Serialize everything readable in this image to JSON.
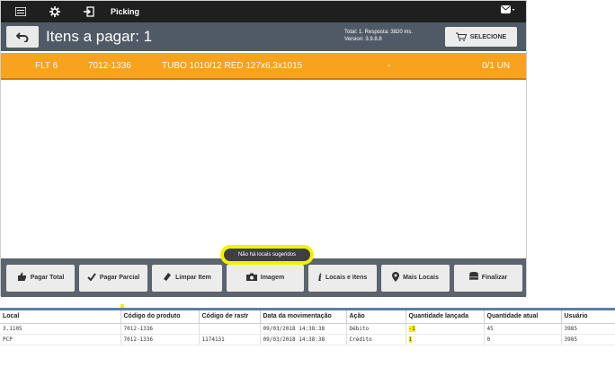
{
  "topbar": {
    "title": "Picking"
  },
  "subbar": {
    "title": "Itens a pagar: 1",
    "info_line1": "Total: 1. Resposta: 3820 ms.",
    "info_line2": "Version: 3.9.8.8",
    "select_label": "SELECIONE"
  },
  "item": {
    "location": "FLT 6",
    "code": "7012-1336",
    "description": "TUBO 1010/12 RED 127x6,3x1015",
    "dash": "-",
    "quantity": "0/1 UN"
  },
  "tooltip": "Não há locais sugeridos",
  "buttons": [
    {
      "label": "Pagar Total",
      "icon": "thumbs-up-icon"
    },
    {
      "label": "Pagar Parcial",
      "icon": "check-icon"
    },
    {
      "label": "Limpar Item",
      "icon": "eraser-icon"
    },
    {
      "label": "Imagem",
      "icon": "camera-icon"
    },
    {
      "label": "Locais e Itens",
      "icon": "info-icon"
    },
    {
      "label": "Mais Locais",
      "icon": "map-pin-icon"
    },
    {
      "label": "Finalizar",
      "icon": "database-icon"
    }
  ],
  "table": {
    "headers": [
      "Local",
      "Código do produto",
      "Código de rastr",
      "Data da movimentação",
      "Ação",
      "Quantidade lançada",
      "Quantidade atual",
      "Usuário"
    ],
    "rows": [
      [
        "3.1105",
        "7012-1336",
        "",
        "09/03/2018 14:38:38",
        "Débito",
        "-1",
        "45",
        "3985"
      ],
      [
        "PCP",
        "7012-1336",
        "1174131",
        "09/03/2018 14:38:38",
        "Crédito",
        "1",
        "0",
        "3985"
      ]
    ]
  },
  "colors": {
    "accent": "#f8a21e",
    "bar": "#505a66",
    "highlight": "#f4f400"
  }
}
